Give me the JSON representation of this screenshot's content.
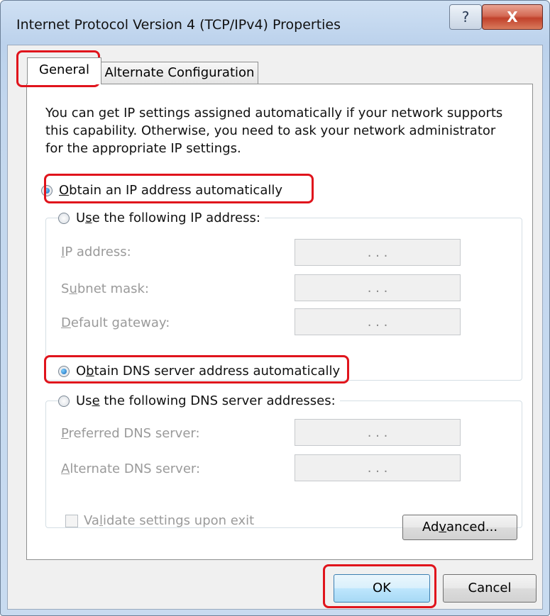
{
  "window": {
    "title": "Internet Protocol Version 4 (TCP/IPv4) Properties",
    "help_glyph": "?",
    "close_glyph": "X"
  },
  "tabs": [
    {
      "label": "General",
      "selected": true
    },
    {
      "label": "Alternate Configuration",
      "selected": false
    }
  ],
  "intro_text": "You can get IP settings assigned automatically if your network supports this capability. Otherwise, you need to ask your network administrator for the appropriate IP settings.",
  "ip_section": {
    "auto_option": {
      "label_pre": "",
      "label_key": "O",
      "label_post": "btain an IP address automatically",
      "checked": true
    },
    "manual_option": {
      "label_pre": "U",
      "label_key": "s",
      "label_post": "e the following IP address:",
      "checked": false
    },
    "fields": [
      {
        "label_pre": "",
        "label_key": "I",
        "label_post": "P address:",
        "value": ".      .      ."
      },
      {
        "label_pre": "S",
        "label_key": "u",
        "label_post": "bnet mask:",
        "value": ".      .      ."
      },
      {
        "label_pre": "",
        "label_key": "D",
        "label_post": "efault gateway:",
        "value": ".      .      ."
      }
    ]
  },
  "dns_section": {
    "auto_option": {
      "label_pre": "O",
      "label_key": "b",
      "label_post": "tain DNS server address automatically",
      "checked": true
    },
    "manual_option": {
      "label_pre": "Us",
      "label_key": "e",
      "label_post": " the following DNS server addresses:",
      "checked": false
    },
    "fields": [
      {
        "label_pre": "",
        "label_key": "P",
        "label_post": "referred DNS server:",
        "value": ".      .      ."
      },
      {
        "label_pre": "",
        "label_key": "A",
        "label_post": "lternate DNS server:",
        "value": ".      .      ."
      }
    ]
  },
  "validate": {
    "label_pre": "Va",
    "label_key": "l",
    "label_post": "idate settings upon exit",
    "checked": false
  },
  "buttons": {
    "advanced": {
      "pre": "Ad",
      "key": "v",
      "post": "anced..."
    },
    "ok": "OK",
    "cancel": "Cancel"
  },
  "colors": {
    "highlight": "#e0141c",
    "radio_selected": "#1566b8"
  }
}
